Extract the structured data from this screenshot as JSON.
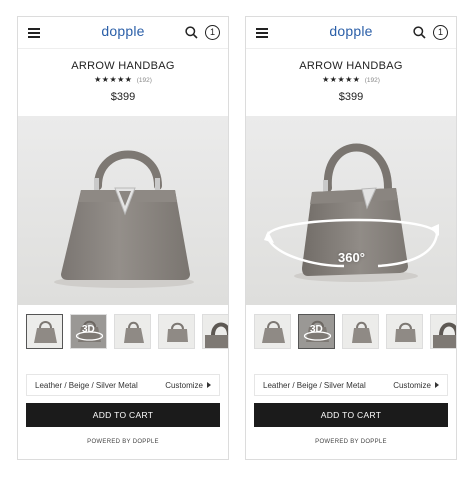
{
  "header": {
    "logo": "dopple",
    "cart_count": "1"
  },
  "product": {
    "name": "ARROW HANDBAG",
    "stars": "★★★★★",
    "review_count": "(192)",
    "price": "$399"
  },
  "hero_b": {
    "badge": "360°"
  },
  "thumbnails": {
    "threed_label": "3D"
  },
  "customize": {
    "options": "Leather / Beige / Silver Metal",
    "link": "Customize"
  },
  "cta": {
    "add_to_cart": "ADD TO CART"
  },
  "footer": {
    "powered_by": "POWERED BY DOPPLE"
  },
  "colors": {
    "logo": "#2b5fa8",
    "button": "#1b1b1b",
    "bag": "#8c8782"
  }
}
